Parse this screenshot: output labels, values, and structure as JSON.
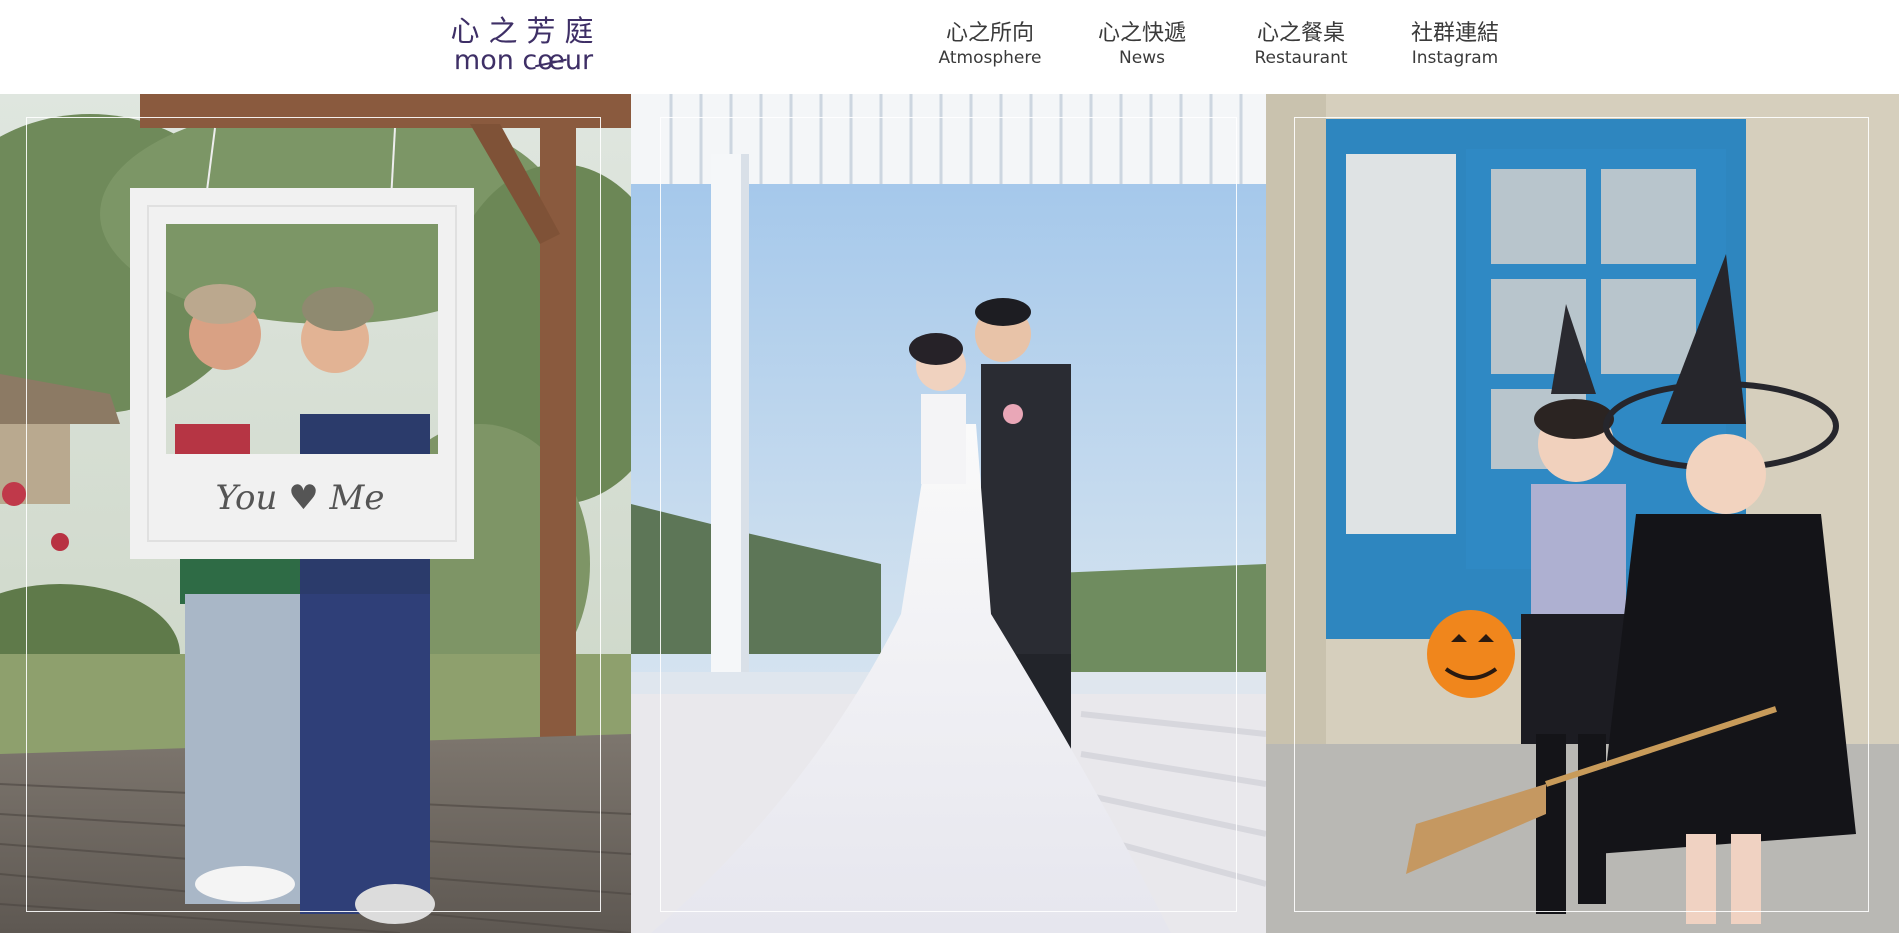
{
  "brand": {
    "name_cn": "心之芳庭",
    "name_en_parts": [
      "mon c",
      "œ",
      "ur"
    ]
  },
  "nav": {
    "items": [
      {
        "cn": "心之所向",
        "en": "Atmosphere"
      },
      {
        "cn": "心之快遞",
        "en": "News"
      },
      {
        "cn": "心之餐桌",
        "en": "Restaurant"
      },
      {
        "cn": "社群連結",
        "en": "Instagram"
      }
    ]
  },
  "gallery": {
    "panels": [
      {
        "label": "couple-photo-frame",
        "frame_text": "You ♥ Me"
      },
      {
        "label": "wedding-couple"
      },
      {
        "label": "halloween-kids"
      }
    ]
  },
  "colors": {
    "brand_purple": "#3e2f66",
    "nav_text": "#3a3a3a",
    "heart": "#e8a0a8"
  }
}
